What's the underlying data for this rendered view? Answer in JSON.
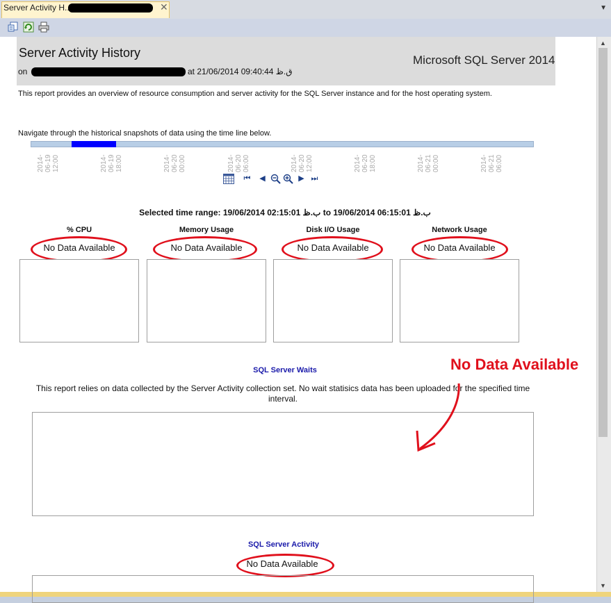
{
  "tab": {
    "title": "Server Activity H..."
  },
  "toolbar": {
    "icons": [
      "document-map-icon",
      "refresh-icon",
      "print-icon"
    ]
  },
  "report": {
    "title": "Server Activity History",
    "on_label": "on",
    "at_text": "at 21/06/2014 09:40:44 ق.ظ",
    "brand": "Microsoft SQL Server 2014",
    "description": "This report provides an overview of resource consumption and server activity for the SQL Server instance and for the host operating system.",
    "navigate_text": "Navigate through the historical snapshots of data using the time line below.",
    "timeline_ticks": [
      "2014-\n06-19\n12:00",
      "2014-\n06-19\n18:00",
      "2014-\n06-20\n00:00",
      "2014-\n06-20\n06:00",
      "2014-\n06-20\n12:00",
      "2014-\n06-20\n18:00",
      "2014-\n06-21\n00:00",
      "2014-\n06-21\n06:00"
    ],
    "selected_range": "Selected time range:  19/06/2014 02:15:01 ب.ظ  to  19/06/2014 06:15:01 ب.ظ"
  },
  "charts": [
    {
      "title": "% CPU",
      "status": "No Data Available"
    },
    {
      "title": "Memory Usage",
      "status": "No Data Available"
    },
    {
      "title": "Disk I/O Usage",
      "status": "No Data Available"
    },
    {
      "title": "Network Usage",
      "status": "No Data Available"
    }
  ],
  "waits": {
    "title": "SQL Server Waits",
    "message": "This report relies on data collected by the Server Activity collection set.  No wait statisics data has been uploaded for the specified time interval."
  },
  "annotation": {
    "text": "No Data Available",
    "color": "#e0101c"
  },
  "activity": {
    "title": "SQL Server Activity",
    "status": "No Data Available"
  },
  "colors": {
    "accent": "#0000ff",
    "highlight": "#e0101c",
    "header_bg": "#dcdcdc"
  }
}
